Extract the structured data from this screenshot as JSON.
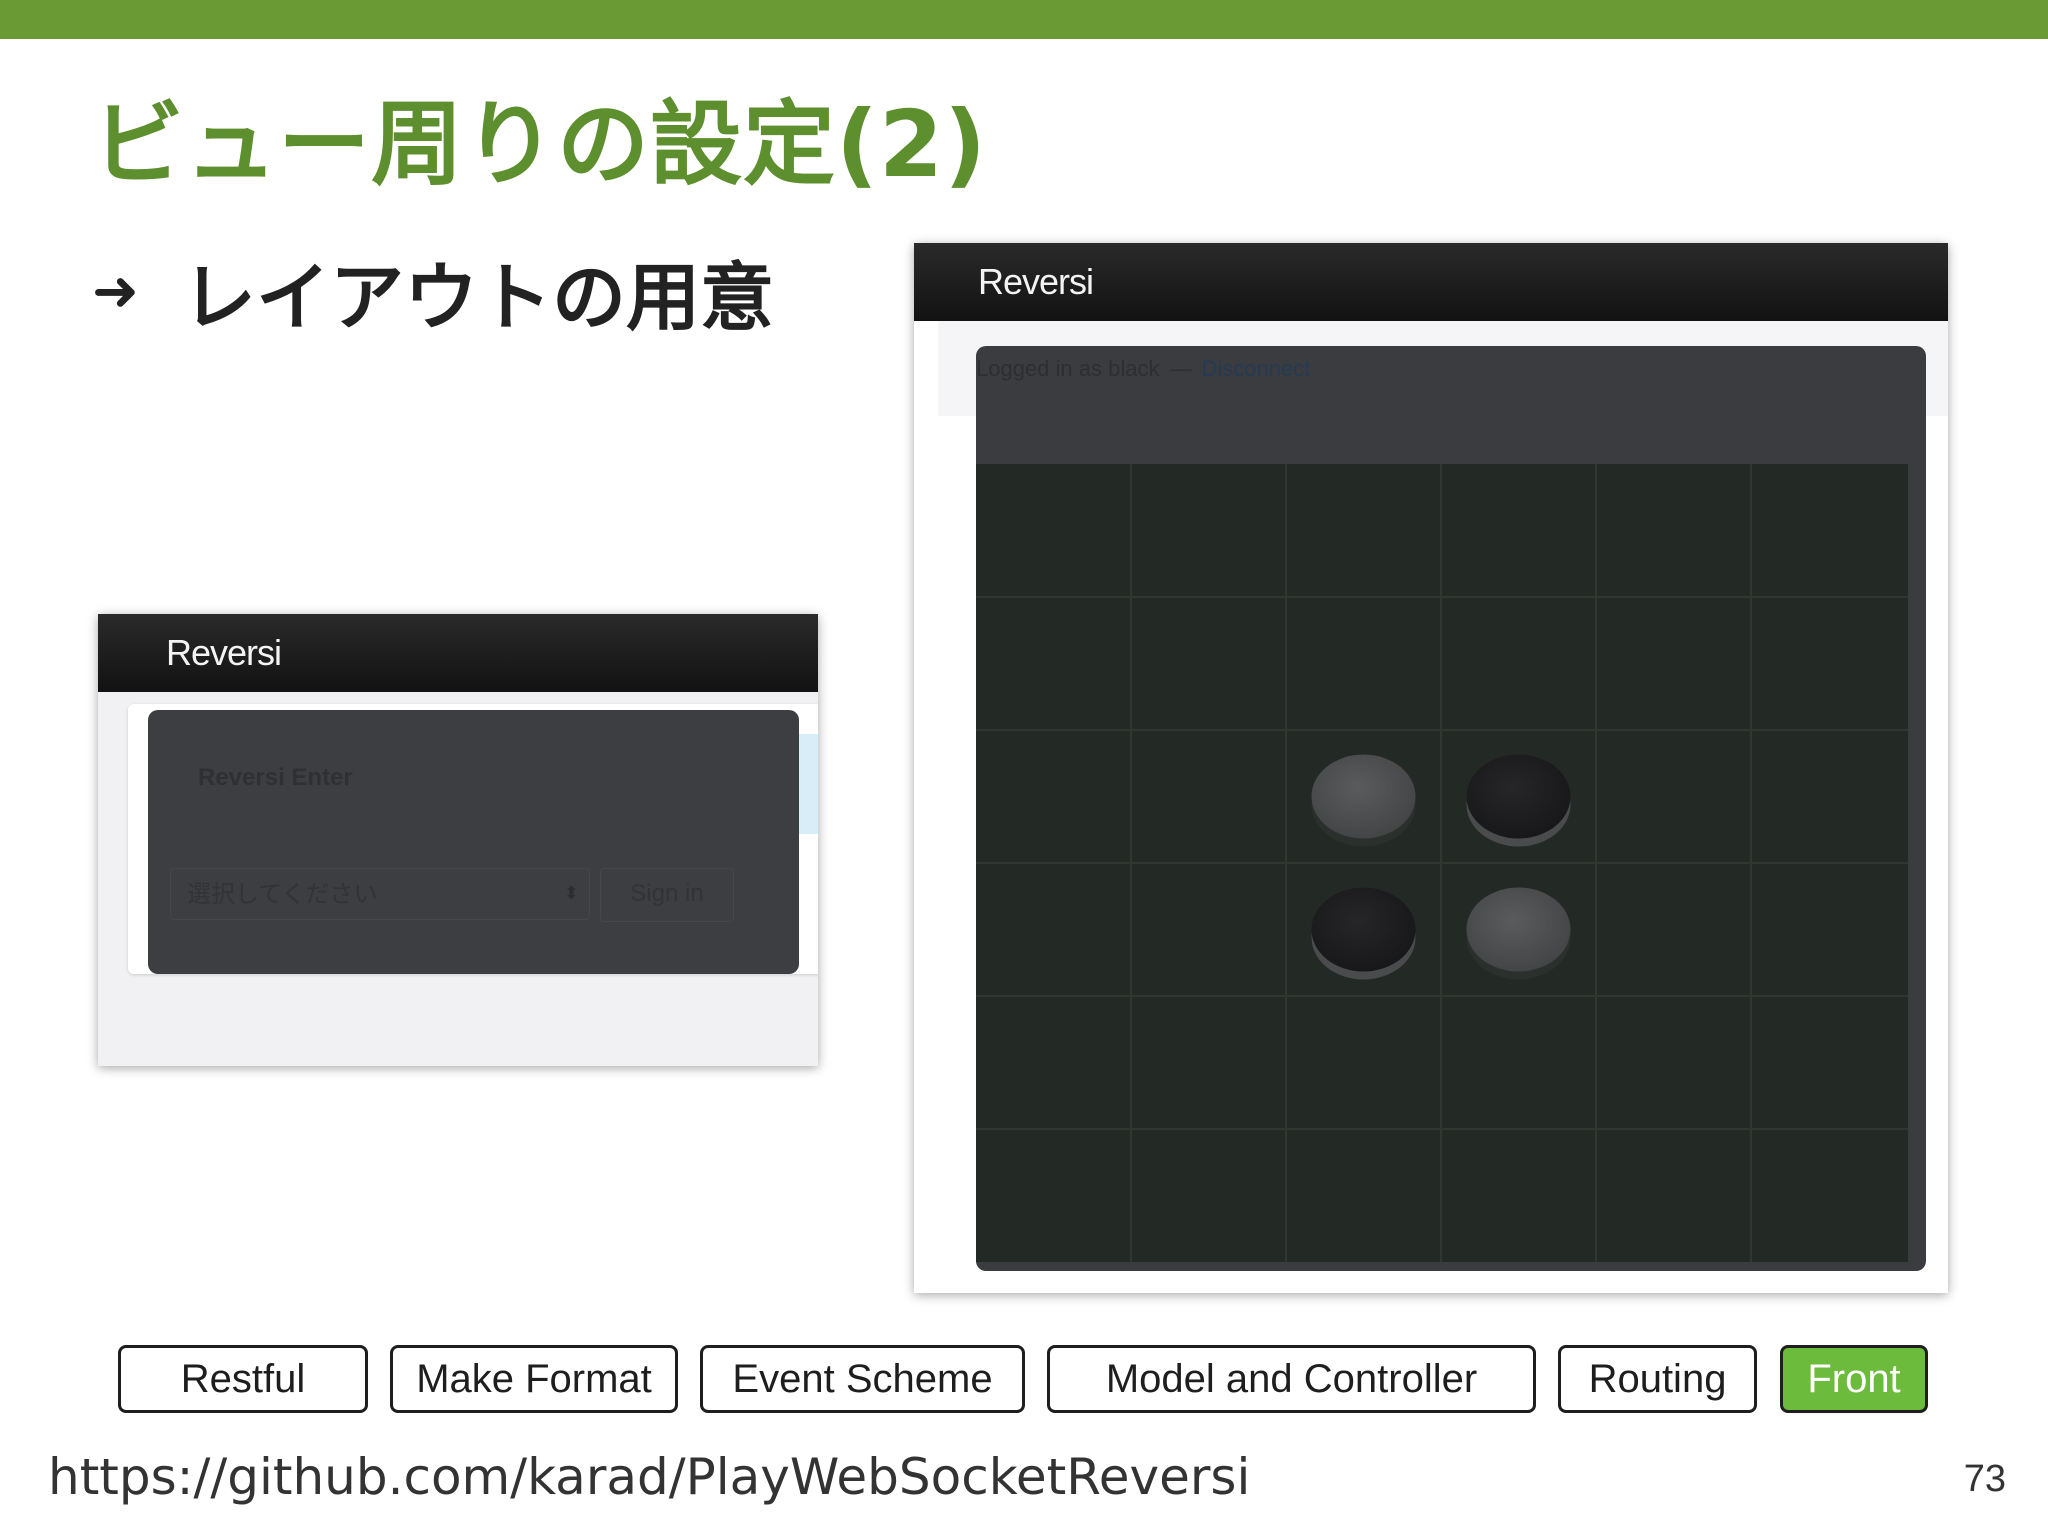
{
  "slide": {
    "title": "ビュー周りの設定(2)",
    "bullet_arrow": "➜",
    "bullet": "レイアウトの用意"
  },
  "login_window": {
    "app_title": "Reversi",
    "heading": "Reversi Enter",
    "select_placeholder": "選択してください",
    "select_arrows": "⬍",
    "signin_label": "Sign in"
  },
  "game_window": {
    "app_title": "Reversi",
    "status_text": "Logged in as black",
    "status_separator": "—",
    "disconnect_link": "Disconnect",
    "board": {
      "visible_cols": 6,
      "visible_rows": 6,
      "pieces": [
        {
          "col": 2,
          "row": 2,
          "color": "gray"
        },
        {
          "col": 3,
          "row": 2,
          "color": "black"
        },
        {
          "col": 2,
          "row": 3,
          "color": "black"
        },
        {
          "col": 3,
          "row": 3,
          "color": "gray"
        }
      ]
    }
  },
  "footer": {
    "tabs": [
      "Restful",
      "Make Format",
      "Event Scheme",
      "Model and Controller",
      "Routing",
      "Front"
    ],
    "active_tab": "Front",
    "url": "https://github.com/karad/PlayWebSocketReversi",
    "page_number": "73"
  },
  "colors": {
    "accent_green": "#6a9a33",
    "title_green": "#5e8f2e",
    "active_tab": "#6cbb3c"
  }
}
